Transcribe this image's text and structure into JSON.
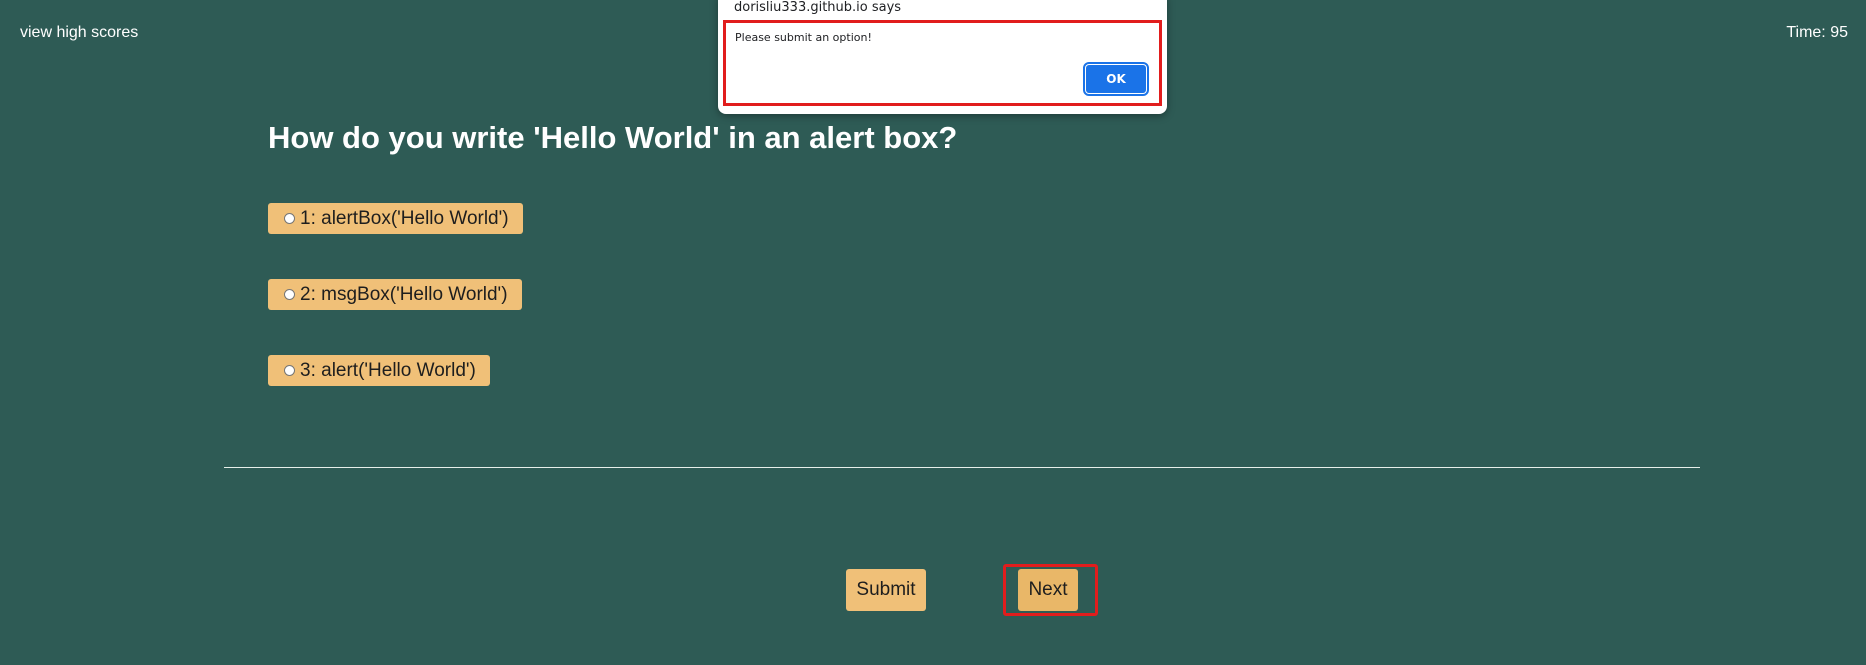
{
  "header": {
    "high_scores_link": "view high scores",
    "timer_text": "Time: 95"
  },
  "quiz": {
    "question": "How do you write 'Hello World' in an alert box?",
    "options": [
      {
        "label": "1: alertBox('Hello World')",
        "selected": false
      },
      {
        "label": "2: msgBox('Hello World')",
        "selected": false
      },
      {
        "label": "3: alert('Hello World')",
        "selected": false
      }
    ],
    "submit_label": "Submit",
    "next_label": "Next"
  },
  "alert_dialog": {
    "origin": "dorisliu333.github.io says",
    "message": "Please submit an option!",
    "ok_label": "OK"
  },
  "colors": {
    "background": "#2e5b55",
    "option_fill": "#f0c078",
    "highlight_outline": "#e11d1d",
    "dialog_button": "#1a73e8"
  }
}
